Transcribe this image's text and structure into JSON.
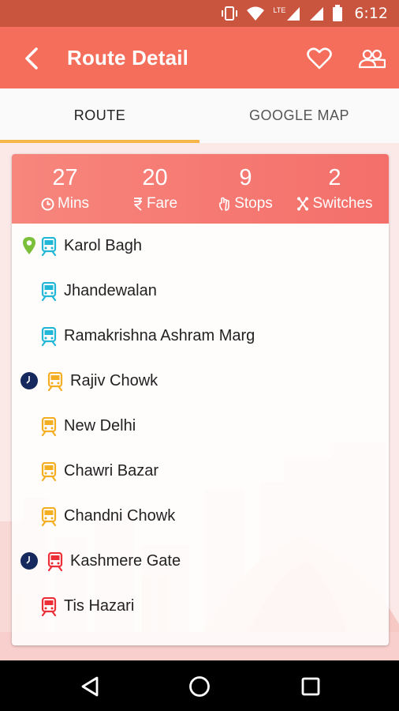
{
  "status_bar": {
    "time": "6:12",
    "lte_label": "LTE",
    "icons": [
      "vibrate-icon",
      "wifi-icon",
      "signal-icon",
      "signal-icon",
      "battery-icon"
    ]
  },
  "app_bar": {
    "title": "Route Detail",
    "icons": [
      "back-arrow-icon",
      "heart-icon",
      "people-icon"
    ]
  },
  "tabs": [
    {
      "label": "ROUTE",
      "selected": true
    },
    {
      "label": "GOOGLE MAP",
      "selected": false
    }
  ],
  "summary": {
    "mins": {
      "value": "27",
      "label": "Mins",
      "icon": "clock-icon"
    },
    "fare": {
      "value": "20",
      "label": "Fare",
      "icon": "rupee-icon"
    },
    "stops": {
      "value": "9",
      "label": "Stops",
      "icon": "hand-icon"
    },
    "switches": {
      "value": "2",
      "label": "Switches",
      "icon": "switch-icon"
    }
  },
  "colors": {
    "header": "#f56e5c",
    "status_bar": "#c9553e",
    "tab_indicator": "#f6b547",
    "blue_line": "#22b7d6",
    "yellow_line": "#f4ae22",
    "red_line": "#ec2f36",
    "start_pin": "#7bbf3a",
    "interchange": "#16295e"
  },
  "stations": [
    {
      "name": "Karol Bagh",
      "line": "blue",
      "marker": "start-pin-icon"
    },
    {
      "name": "Jhandewalan",
      "line": "blue",
      "marker": ""
    },
    {
      "name": "Ramakrishna Ashram Marg",
      "line": "blue",
      "marker": ""
    },
    {
      "name": "Rajiv Chowk",
      "line": "yellow",
      "marker": "interchange-icon"
    },
    {
      "name": "New Delhi",
      "line": "yellow",
      "marker": ""
    },
    {
      "name": "Chawri Bazar",
      "line": "yellow",
      "marker": ""
    },
    {
      "name": "Chandni Chowk",
      "line": "yellow",
      "marker": ""
    },
    {
      "name": "Kashmere Gate",
      "line": "red",
      "marker": "interchange-icon"
    },
    {
      "name": "Tis Hazari",
      "line": "red",
      "marker": ""
    }
  ],
  "nav_bar": {
    "icons": [
      "back-triangle-icon",
      "home-circle-icon",
      "recents-square-icon"
    ]
  }
}
